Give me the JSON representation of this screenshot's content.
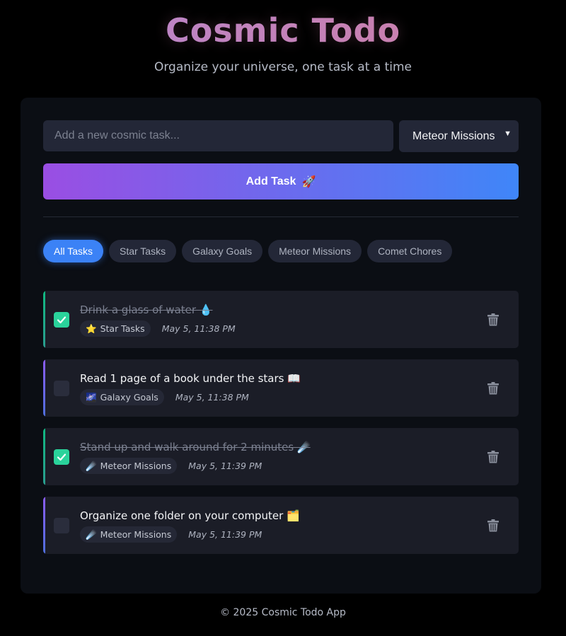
{
  "header": {
    "title": "Cosmic Todo",
    "subtitle": "Organize your universe, one task at a time"
  },
  "form": {
    "input_placeholder": "Add a new cosmic task...",
    "input_value": "",
    "category_selected": "Meteor Missions",
    "add_button_label": "Add Task",
    "add_button_icon": "🚀"
  },
  "filters": [
    {
      "label": "All Tasks",
      "active": true
    },
    {
      "label": "Star Tasks",
      "active": false
    },
    {
      "label": "Galaxy Goals",
      "active": false
    },
    {
      "label": "Meteor Missions",
      "active": false
    },
    {
      "label": "Comet Chores",
      "active": false
    }
  ],
  "tasks": [
    {
      "text": "Drink a glass of water 💧",
      "completed": true,
      "category_icon": "⭐",
      "category": "Star Tasks",
      "timestamp": "May 5, 11:38 PM"
    },
    {
      "text": "Read 1 page of a book under the stars 📖",
      "completed": false,
      "category_icon": "🌌",
      "category": "Galaxy Goals",
      "timestamp": "May 5, 11:38 PM"
    },
    {
      "text": "Stand up and walk around for 2 minutes ☄️",
      "completed": true,
      "category_icon": "☄️",
      "category": "Meteor Missions",
      "timestamp": "May 5, 11:39 PM"
    },
    {
      "text": "Organize one folder on your computer 🗂️",
      "completed": false,
      "category_icon": "☄️",
      "category": "Meteor Missions",
      "timestamp": "May 5, 11:39 PM"
    }
  ],
  "footer": {
    "text": "© 2025 Cosmic Todo App"
  },
  "colors": {
    "accent_blue": "#3b82f6",
    "accent_purple": "#9a4ee3",
    "done_green": "#2ad39b",
    "background": "#000000",
    "card": "#0b0e14"
  }
}
